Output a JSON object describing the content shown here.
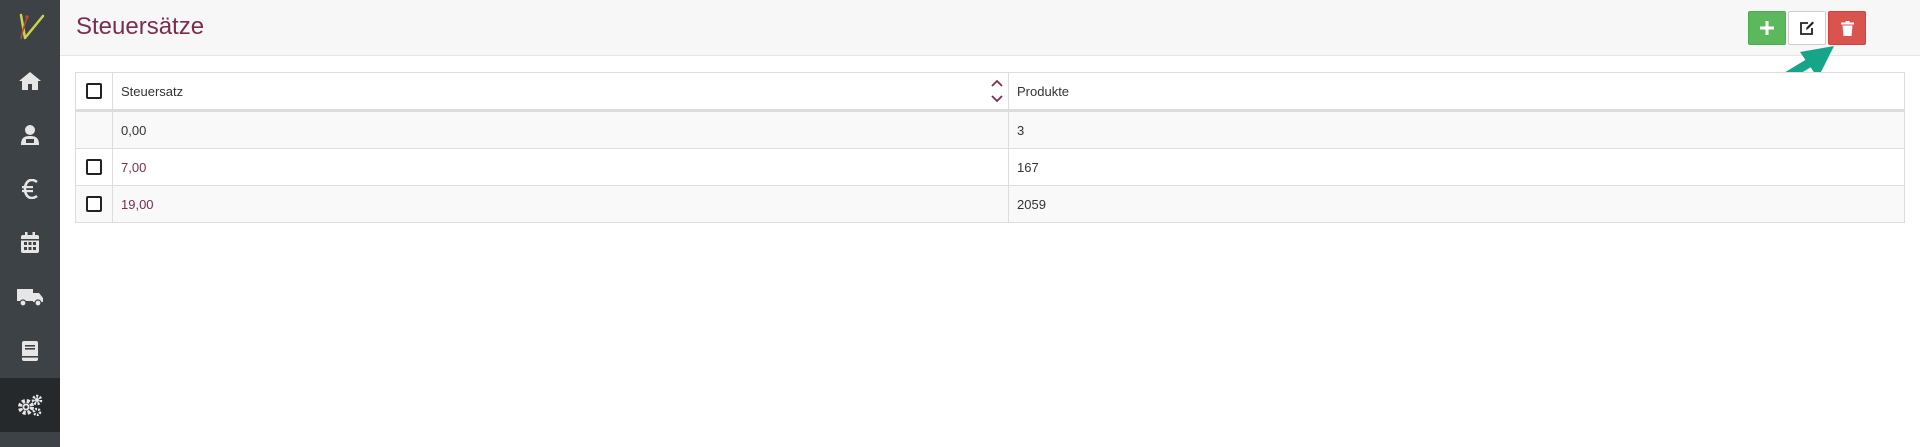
{
  "page": {
    "title": "Steuersätze"
  },
  "toolbar": {
    "add_icon": "plus-icon",
    "edit_icon": "edit-icon",
    "delete_icon": "trash-icon"
  },
  "sidebar": {
    "items": [
      {
        "icon": "home-icon"
      },
      {
        "icon": "user-icon"
      },
      {
        "icon": "euro-icon"
      },
      {
        "icon": "calendar-icon"
      },
      {
        "icon": "truck-icon"
      },
      {
        "icon": "book-icon"
      },
      {
        "icon": "gears-icon",
        "active": true
      }
    ]
  },
  "table": {
    "columns": [
      "Steuersatz",
      "Produkte"
    ],
    "rows": [
      {
        "rate": "0,00",
        "products": "3",
        "selectable": false
      },
      {
        "rate": "7,00",
        "products": "167",
        "selectable": true
      },
      {
        "rate": "19,00",
        "products": "2059",
        "selectable": true
      }
    ]
  },
  "colors": {
    "accent": "#7a2d4f",
    "success": "#5cb85c",
    "danger": "#d9534f",
    "sidebar": "#3d4247",
    "callout": "#17a589"
  }
}
